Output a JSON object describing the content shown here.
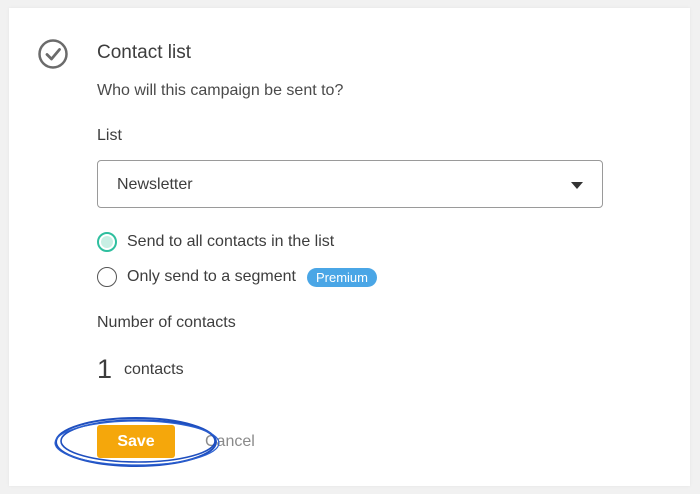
{
  "section": {
    "title": "Contact list",
    "question": "Who will this campaign be sent to?"
  },
  "list": {
    "label": "List",
    "selected": "Newsletter"
  },
  "options": [
    {
      "label": "Send to all contacts in the list",
      "selected": true
    },
    {
      "label": "Only send to a segment",
      "selected": false,
      "badge": "Premium"
    }
  ],
  "contacts": {
    "label": "Number of contacts",
    "count": "1",
    "unit": "contacts"
  },
  "actions": {
    "save_label": "Save",
    "cancel_label": "Cancel"
  },
  "colors": {
    "accent_save": "#f5a70b",
    "radio_selected": "#2fbf9f",
    "badge": "#4aa6e6",
    "highlight_ring": "#1f4fbf"
  },
  "icons": {
    "status": "check-circle-icon",
    "dropdown": "caret-down-icon"
  }
}
